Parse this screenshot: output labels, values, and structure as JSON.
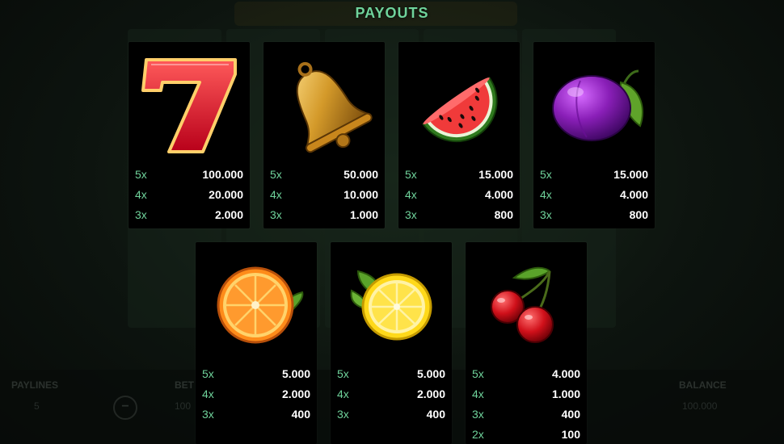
{
  "title": "PAYOUTS",
  "background": {
    "paylines_label": "PAYLINES",
    "paylines_value": "5",
    "bet_label": "BET",
    "bet_value": "100",
    "balance_label": "BALANCE",
    "balance_value": "100.000"
  },
  "colors": {
    "accent": "#6fd39b",
    "value": "#ffffff",
    "card": "#000000"
  },
  "symbols": [
    {
      "name": "seven-icon",
      "payouts": [
        {
          "mult": "5x",
          "value": "100.000"
        },
        {
          "mult": "4x",
          "value": "20.000"
        },
        {
          "mult": "3x",
          "value": "2.000"
        }
      ]
    },
    {
      "name": "bell-icon",
      "payouts": [
        {
          "mult": "5x",
          "value": "50.000"
        },
        {
          "mult": "4x",
          "value": "10.000"
        },
        {
          "mult": "3x",
          "value": "1.000"
        }
      ]
    },
    {
      "name": "watermelon-icon",
      "payouts": [
        {
          "mult": "5x",
          "value": "15.000"
        },
        {
          "mult": "4x",
          "value": "4.000"
        },
        {
          "mult": "3x",
          "value": "800"
        }
      ]
    },
    {
      "name": "plum-icon",
      "payouts": [
        {
          "mult": "5x",
          "value": "15.000"
        },
        {
          "mult": "4x",
          "value": "4.000"
        },
        {
          "mult": "3x",
          "value": "800"
        }
      ]
    },
    {
      "name": "orange-icon",
      "payouts": [
        {
          "mult": "5x",
          "value": "5.000"
        },
        {
          "mult": "4x",
          "value": "2.000"
        },
        {
          "mult": "3x",
          "value": "400"
        }
      ]
    },
    {
      "name": "lemon-icon",
      "payouts": [
        {
          "mult": "5x",
          "value": "5.000"
        },
        {
          "mult": "4x",
          "value": "2.000"
        },
        {
          "mult": "3x",
          "value": "400"
        }
      ]
    },
    {
      "name": "cherry-icon",
      "payouts": [
        {
          "mult": "5x",
          "value": "4.000"
        },
        {
          "mult": "4x",
          "value": "1.000"
        },
        {
          "mult": "3x",
          "value": "400"
        },
        {
          "mult": "2x",
          "value": "100"
        }
      ]
    }
  ]
}
